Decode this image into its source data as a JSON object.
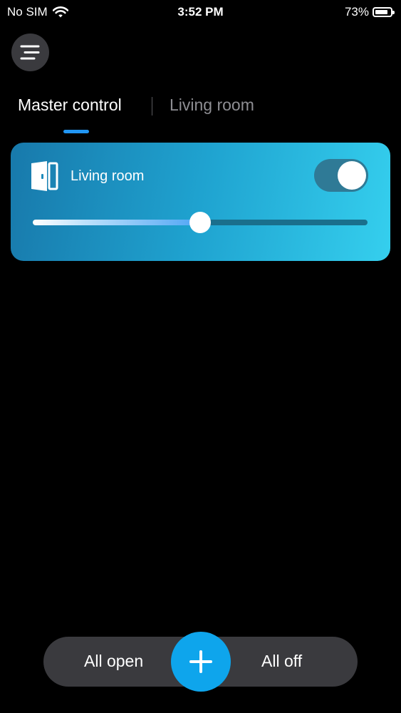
{
  "status_bar": {
    "carrier": "No SIM",
    "time": "3:52 PM",
    "battery": "73%",
    "battery_level": 0.73
  },
  "menu": {
    "icon": "menu-icon"
  },
  "tabs": [
    {
      "label": "Master control",
      "active": true
    },
    {
      "label": "Living room",
      "active": false
    }
  ],
  "room_card": {
    "icon": "door-icon",
    "label": "Living room",
    "toggle_on": true,
    "level": 0.5
  },
  "bottom_bar": {
    "all_open_label": "All open",
    "all_off_label": "All off",
    "add_icon": "plus-icon"
  },
  "colors": {
    "background": "#000000",
    "accent": "#2196f3",
    "add_button": "#0ea5ec",
    "card_start": "#1879ab",
    "card_end": "#35cfee"
  }
}
